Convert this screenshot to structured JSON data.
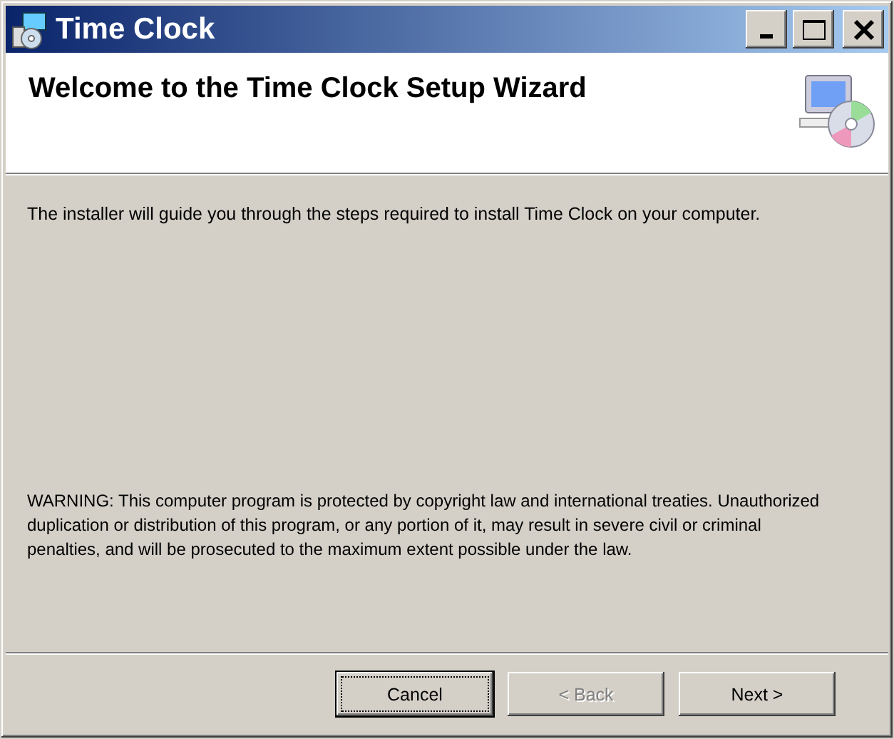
{
  "window": {
    "title": "Time Clock"
  },
  "header": {
    "title": "Welcome to the Time Clock Setup Wizard"
  },
  "intro": "The installer will guide you through the steps required to install Time Clock on your computer.",
  "warning": "WARNING: This computer program is protected by copyright law and international treaties. Unauthorized duplication or distribution of this program, or any portion of it, may result in severe civil or criminal penalties, and will be prosecuted to the maximum extent possible under the law.",
  "buttons": [
    {
      "label": "Cancel",
      "disabled": false,
      "focused": true
    },
    {
      "label": "< Back",
      "disabled": true,
      "focused": false
    },
    {
      "label": "Next >",
      "disabled": false,
      "focused": false
    }
  ]
}
